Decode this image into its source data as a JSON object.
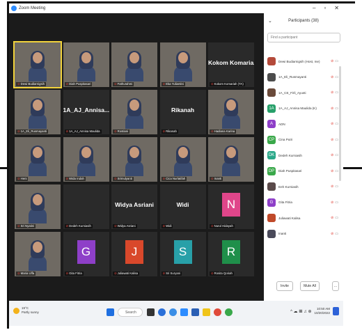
{
  "window": {
    "title": "Zoom Meeting",
    "controls": [
      "–",
      "▫",
      "✕"
    ]
  },
  "participants_panel": {
    "collapse_symbol": "⌄",
    "title": "Participants (38)",
    "search_placeholder": "Find a participant",
    "items": [
      {
        "name": "Dewi Budiarnigsih (Host, me)",
        "avatar": "photo",
        "color": "#b44a3a"
      },
      {
        "name": "1A_Eli_Rusmayanti",
        "avatar": "photo",
        "color": "#4c4c4c"
      },
      {
        "name": "1A_CE_Firli_Ayusti",
        "avatar": "photo",
        "color": "#6a4a3a"
      },
      {
        "name": "1A_AJ_Annisa Maulida (K)",
        "avatar": "1A",
        "color": "#27a06a"
      },
      {
        "name": "ADN",
        "avatar": "A",
        "color": "#8e3fc8"
      },
      {
        "name": "Cina Putri",
        "avatar": "CP",
        "color": "#3aa84a"
      },
      {
        "name": "Dedeh Kurniasih",
        "avatar": "DK",
        "color": "#2aa889"
      },
      {
        "name": "Diah Puspitasari",
        "avatar": "DP",
        "color": "#3aa84a"
      },
      {
        "name": "Eeh Kurniasih",
        "avatar": "photo",
        "color": "#5a4a4a"
      },
      {
        "name": "Gita Fitria",
        "avatar": "G",
        "color": "#8e3fc8"
      },
      {
        "name": "Juliawati Kalisa",
        "avatar": "photo",
        "color": "#c04a2a"
      },
      {
        "name": "Inanti",
        "avatar": "photo",
        "color": "#4a4a5a"
      }
    ],
    "invite_label": "Invite",
    "mute_all_label": "Mute All",
    "more_label": "..."
  },
  "gallery": {
    "tiles": [
      {
        "label": "Dewi Budiarnigsih",
        "kind": "video",
        "active": true
      },
      {
        "label": "Diah Puspitasari",
        "kind": "video"
      },
      {
        "label": "Fathurahmi",
        "kind": "video"
      },
      {
        "label": "Eka Yuliantini",
        "kind": "video"
      },
      {
        "label": "Kokom Komariah (TA)",
        "kind": "name",
        "big": "Kokom Komaria..."
      },
      {
        "label": "1A_Eli_Rusmayanti",
        "kind": "video"
      },
      {
        "label": "1A_AJ_Annisa Maulida",
        "kind": "name",
        "big": "1A_AJ_Annisa..."
      },
      {
        "label": "Rostiani",
        "kind": "video"
      },
      {
        "label": "Rikanah",
        "kind": "name",
        "big": "Rikanah"
      },
      {
        "label": "Hadiana Karina",
        "kind": "video"
      },
      {
        "label": "Heni",
        "kind": "video"
      },
      {
        "label": "Wida Indah",
        "kind": "video"
      },
      {
        "label": "Srimulyanti",
        "kind": "video"
      },
      {
        "label": "Cica Nurlatifah",
        "kind": "video"
      },
      {
        "label": "Inanti",
        "kind": "video"
      },
      {
        "label": "Sri Nyatini",
        "kind": "video"
      },
      {
        "label": "Dedeh Kurniasih",
        "kind": "blank"
      },
      {
        "label": "Widya Asriani",
        "kind": "name",
        "big": "Widya Asriani"
      },
      {
        "label": "Widi",
        "kind": "name",
        "big": "Widi"
      },
      {
        "label": "Nurul Hidayah",
        "kind": "letter",
        "letter": "N",
        "color": "#e0468a"
      },
      {
        "label": "Maria Ulfa",
        "kind": "video"
      },
      {
        "label": "Gita Fitria",
        "kind": "letter",
        "letter": "G",
        "color": "#8e3fc8"
      },
      {
        "label": "Juliawati Kalisa",
        "kind": "letter",
        "letter": "J",
        "color": "#d9482b"
      },
      {
        "label": "Sri Suryani",
        "kind": "letter",
        "letter": "S",
        "color": "#28a0a8"
      },
      {
        "label": "Rosita Qoriah",
        "kind": "letter",
        "letter": "R",
        "color": "#1f8f4a"
      }
    ]
  },
  "taskbar": {
    "weather_temp": "19°C",
    "weather_desc": "Partly sunny",
    "search_label": "Search",
    "time": "10:50 AM",
    "date": "10/20/2022",
    "tray_symbols": "^ ☁ 𝌆 ♫ ⊕"
  }
}
